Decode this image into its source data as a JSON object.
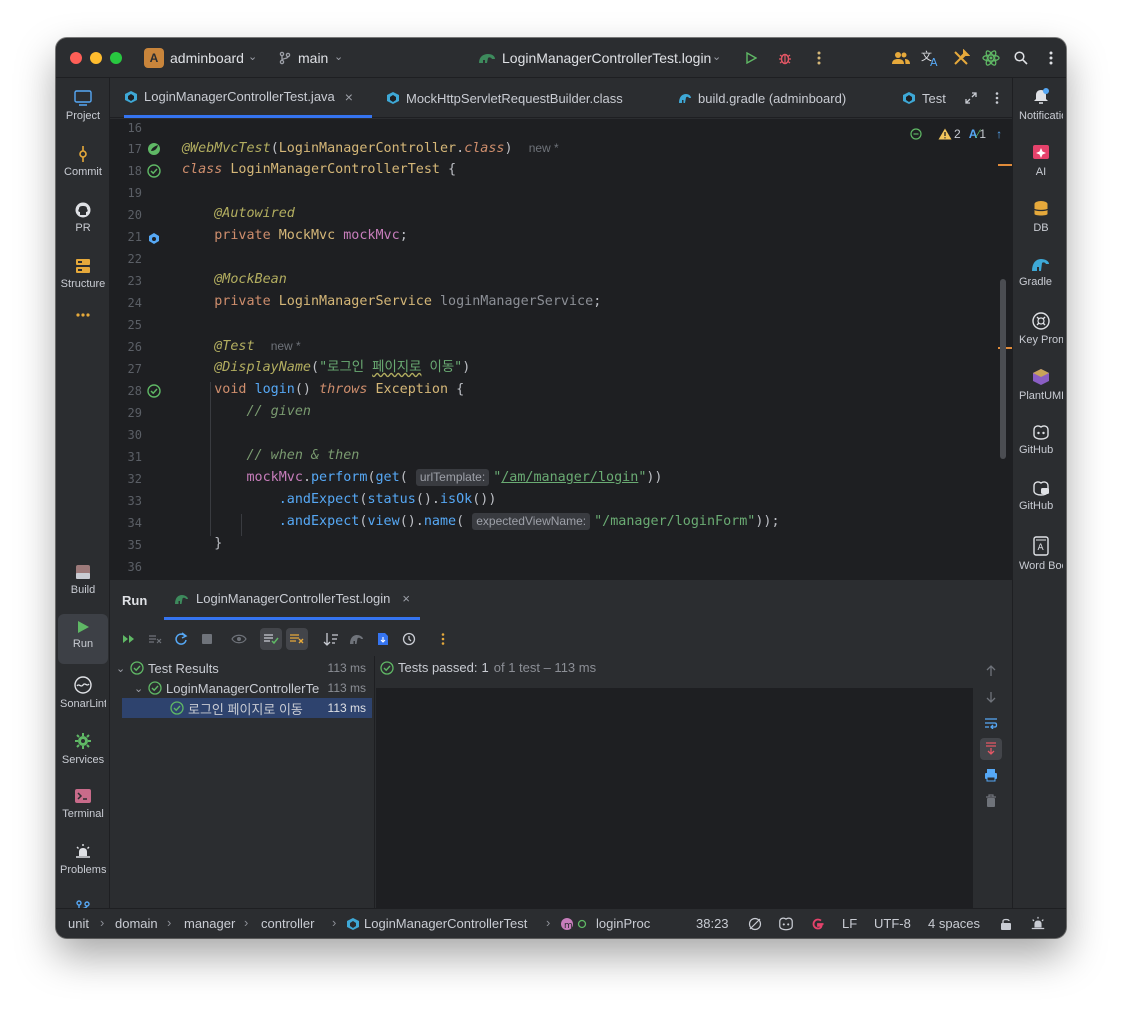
{
  "titlebar": {
    "project_initial": "A",
    "project_name": "adminboard",
    "branch": "main",
    "run_config": "LoginManagerControllerTest.login"
  },
  "left_tools": [
    {
      "label": "Project",
      "icon": "monitor-icon"
    },
    {
      "label": "Commit",
      "icon": "commit-icon"
    },
    {
      "label": "PR",
      "icon": "github-icon"
    },
    {
      "label": "Structure",
      "icon": "structure-icon"
    },
    {
      "label": "...",
      "icon": "more-icon"
    },
    {
      "label": "Build",
      "icon": "build-icon"
    },
    {
      "label": "Run",
      "icon": "run-icon"
    },
    {
      "label": "SonarLint",
      "icon": "sonarlint-icon"
    },
    {
      "label": "Services",
      "icon": "services-icon"
    },
    {
      "label": "Terminal",
      "icon": "terminal-icon"
    },
    {
      "label": "Problems",
      "icon": "problems-icon"
    },
    {
      "label": "Git",
      "icon": "git-icon"
    }
  ],
  "right_tools": [
    {
      "label": "Notifications",
      "icon": "bell-icon"
    },
    {
      "label": "AI",
      "icon": "ai-icon"
    },
    {
      "label": "DB",
      "icon": "database-icon"
    },
    {
      "label": "Gradle",
      "icon": "gradle-icon"
    },
    {
      "label": "Key Promoter",
      "icon": "key-promoter-icon"
    },
    {
      "label": "PlantUML",
      "icon": "plantuml-icon"
    },
    {
      "label": "GitHub",
      "icon": "copilot-icon"
    },
    {
      "label": "GitHub",
      "icon": "copilot-chat-icon"
    },
    {
      "label": "Word Book",
      "icon": "word-book-icon"
    }
  ],
  "tabs": [
    {
      "label": "LoginManagerControllerTest.java",
      "active": true
    },
    {
      "label": "MockHttpServletRequestBuilder.class",
      "active": false
    },
    {
      "label": "build.gradle (adminboard)",
      "active": false
    },
    {
      "label": "Test",
      "active": false
    }
  ],
  "editor": {
    "warnings": "2",
    "typos": "1",
    "line_numbers": [
      "16",
      "17",
      "18",
      "19",
      "20",
      "21",
      "22",
      "23",
      "24",
      "25",
      "26",
      "27",
      "28",
      "29",
      "30",
      "31",
      "32",
      "33",
      "34",
      "35",
      "36"
    ],
    "code": {
      "l17_annotation": "@WebMvcTest",
      "l17_arg": "LoginManagerController",
      "l17_class_kw": "class",
      "l17_new": "new *",
      "l18_kw": "class",
      "l18_name": "LoginManagerControllerTest",
      "l20_annotation": "@Autowired",
      "l21_kw": "private",
      "l21_type": "MockMvc",
      "l21_field": "mockMvc",
      "l23_annotation": "@MockBean",
      "l24_kw": "private",
      "l24_type": "LoginManagerService",
      "l24_field": "loginManagerService",
      "l26_annotation": "@Test",
      "l26_new": "new *",
      "l27_annotation": "@DisplayName",
      "l27_str_a": "\"로그인 ",
      "l27_str_b": "페이지로",
      "l27_str_c": " 이동\"",
      "l28_kw": "void",
      "l28_fn": "login",
      "l28_throws": "throws",
      "l28_ex": "Exception",
      "l29_comment": "// given",
      "l31_comment": "// when & then",
      "l32_field": "mockMvc",
      "l32_perform": "perform",
      "l32_get": "get",
      "l32_hint": "urlTemplate:",
      "l32_str": "/am/manager/login",
      "l33_andExpect": ".andExpect",
      "l33_status": "status",
      "l33_isOk": "isOk",
      "l34_andExpect": ".andExpect",
      "l34_view": "view",
      "l34_name": "name",
      "l34_hint": "expectedViewName:",
      "l34_str": "\"/manager/loginForm\""
    }
  },
  "run_panel": {
    "title": "Run",
    "config_tab": "LoginManagerControllerTest.login",
    "tree": [
      {
        "label": "Test Results",
        "time": "113 ms",
        "level": 0
      },
      {
        "label": "LoginManagerControllerTe",
        "time": "113 ms",
        "level": 1
      },
      {
        "label": "로그인 페이지로 이동",
        "time": "113 ms",
        "level": 2
      }
    ],
    "status_prefix": "Tests passed:",
    "status_count": "1",
    "status_suffix": "of 1 test – 113 ms"
  },
  "statusbar": {
    "breadcrumbs": [
      "unit",
      "domain",
      "manager",
      "controller",
      "LoginManagerControllerTest",
      "loginProc"
    ],
    "position": "38:23",
    "line_ending": "LF",
    "encoding": "UTF-8",
    "indent": "4 spaces"
  },
  "colors": {
    "accent": "#3574f0",
    "pass": "#5fb865",
    "window_bg": "#2b2d30",
    "editor_bg": "#1e1f22"
  }
}
